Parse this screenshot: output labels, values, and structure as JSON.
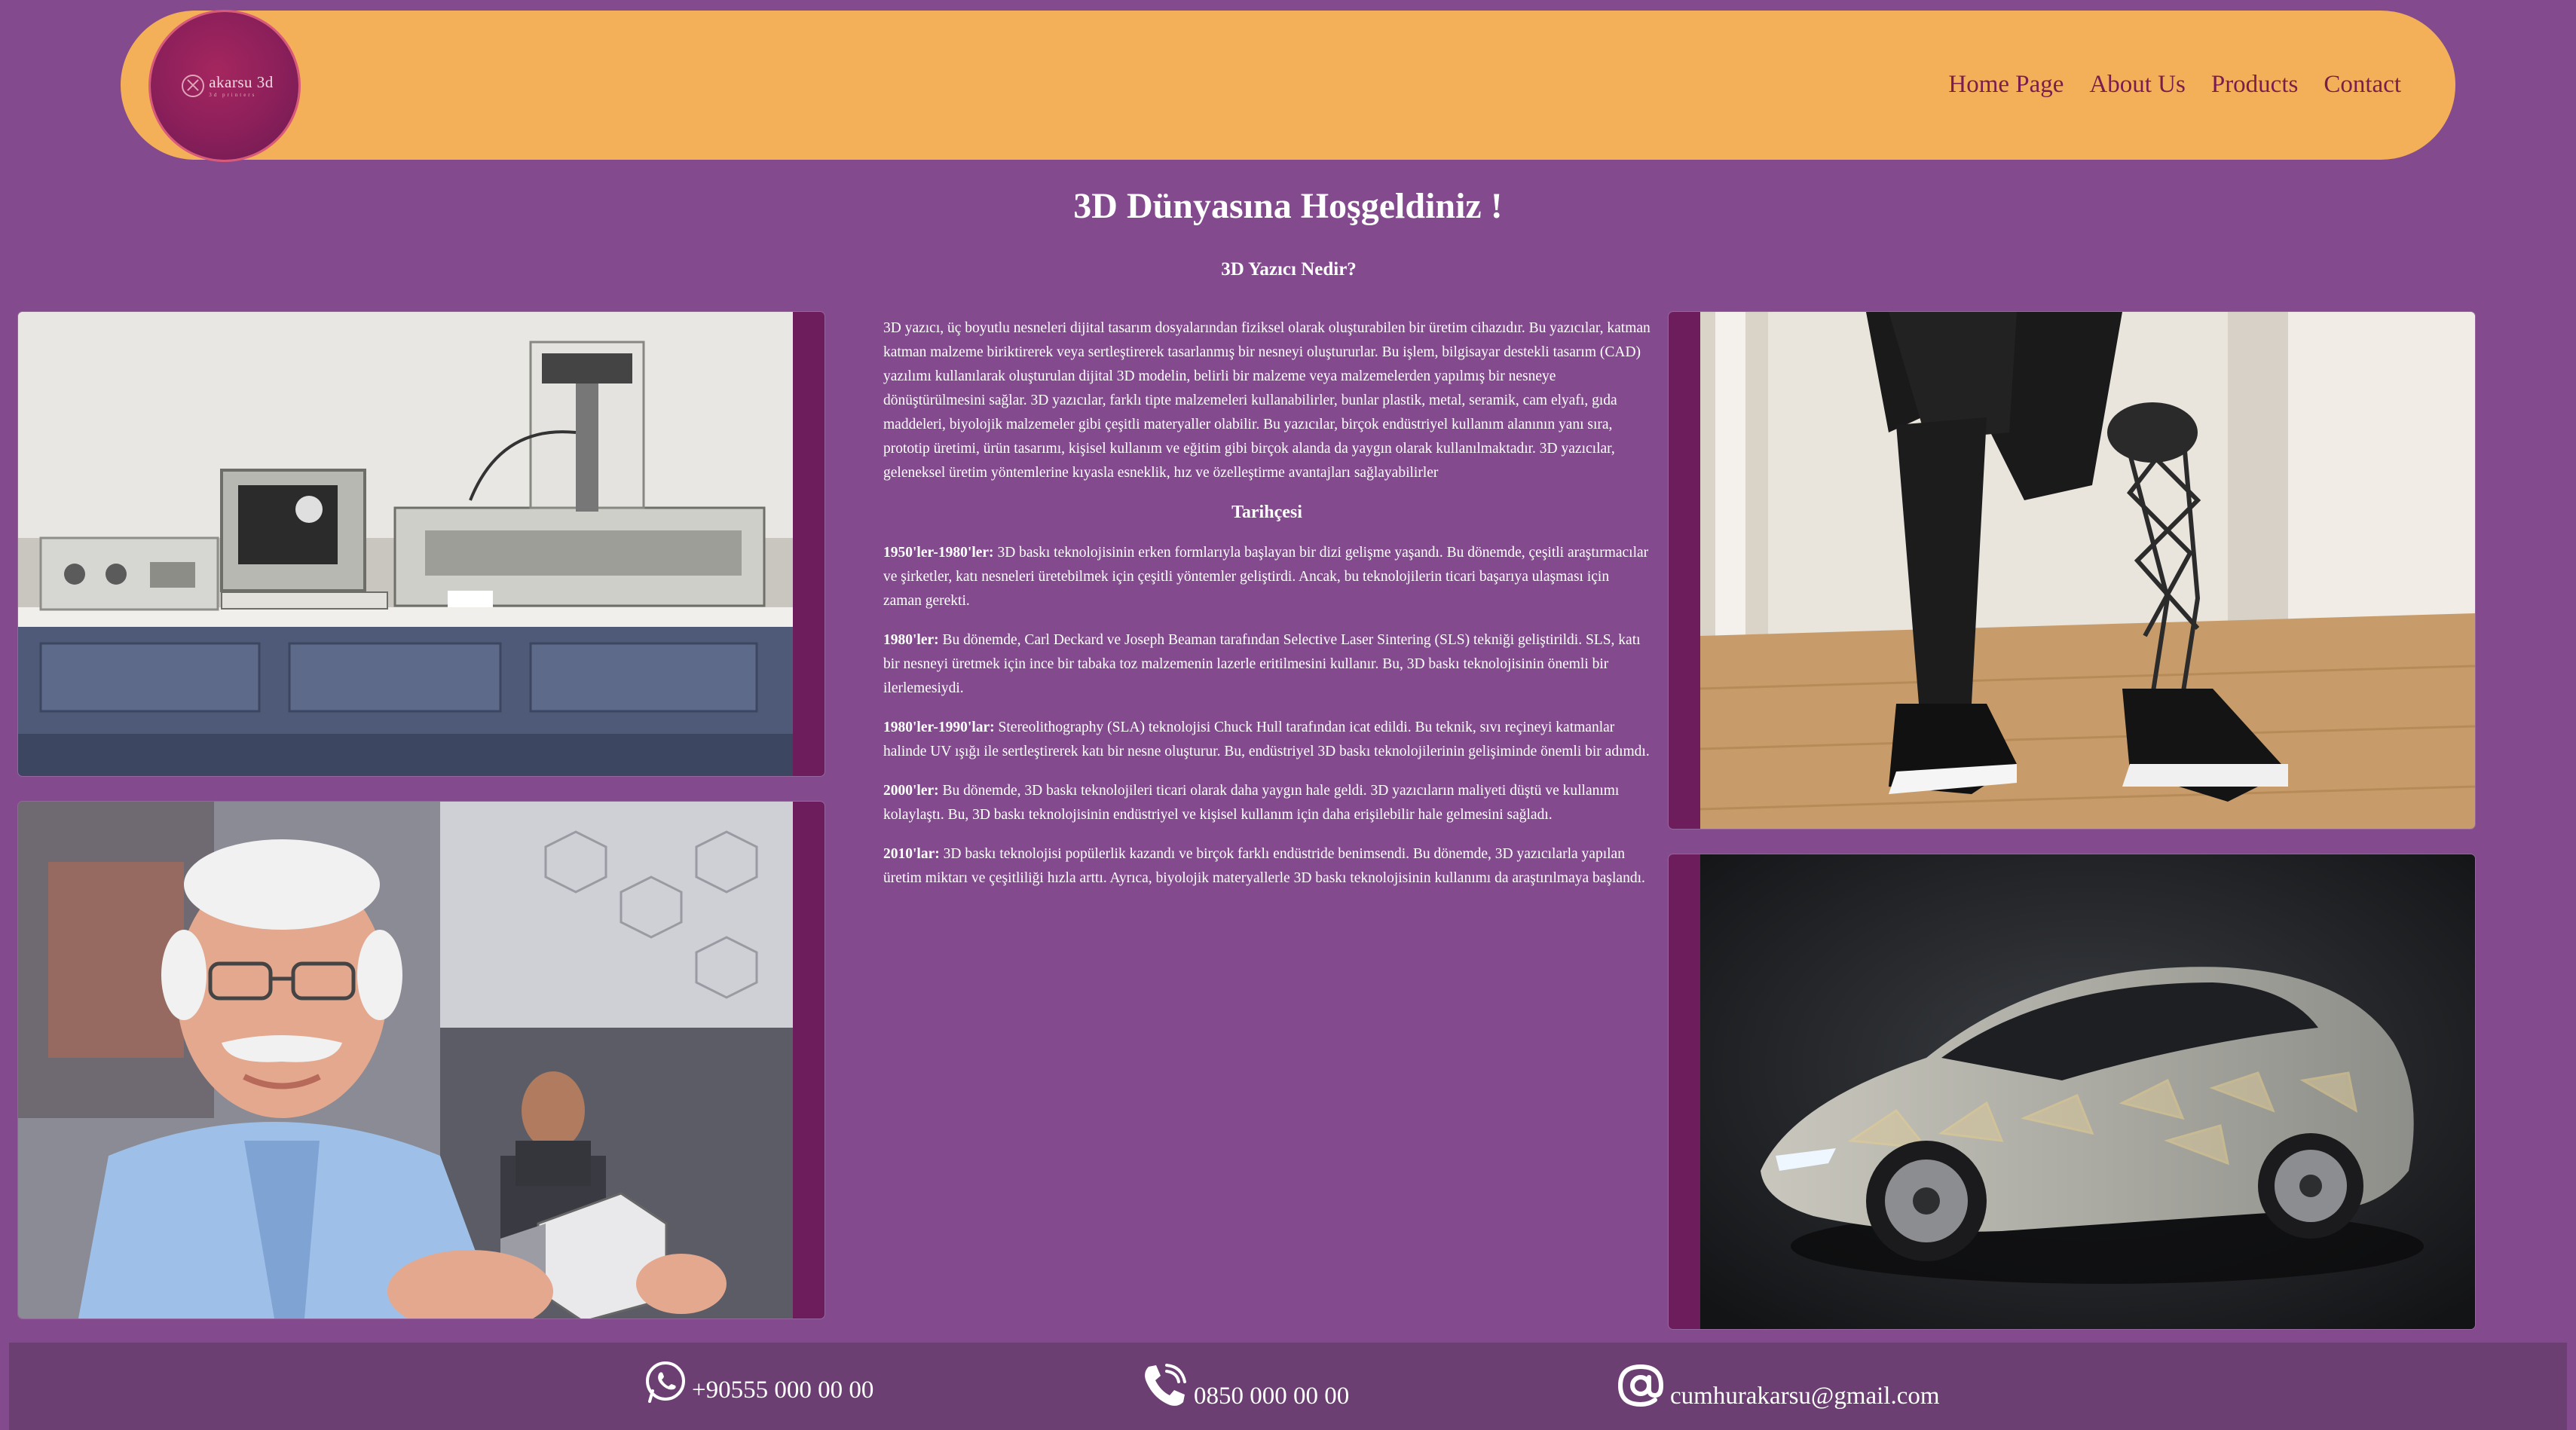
{
  "header": {
    "logo": {
      "name": "akarsu 3d",
      "tagline": "3d printers"
    },
    "nav": [
      "Home Page",
      "About Us",
      "Products",
      "Contact"
    ]
  },
  "main": {
    "title": "3D Dünyasına Hoşgeldiniz !",
    "subtitle": "3D Yazıcı Nedir?",
    "intro": "3D yazıcı, üç boyutlu nesneleri dijital tasarım dosyalarından fiziksel olarak oluşturabilen bir üretim cihazıdır. Bu yazıcılar, katman katman malzeme biriktirerek veya sertleştirerek tasarlanmış bir nesneyi oluştururlar. Bu işlem, bilgisayar destekli tasarım (CAD) yazılımı kullanılarak oluşturulan dijital 3D modelin, belirli bir malzeme veya malzemelerden yapılmış bir nesneye dönüştürülmesini sağlar. 3D yazıcılar, farklı tipte malzemeleri kullanabilirler, bunlar plastik, metal, seramik, cam elyafı, gıda maddeleri, biyolojik malzemeler gibi çeşitli materyaller olabilir. Bu yazıcılar, birçok endüstriyel kullanım alanının yanı sıra, prototip üretimi, ürün tasarımı, kişisel kullanım ve eğitim gibi birçok alanda da yaygın olarak kullanılmaktadır. 3D yazıcılar, geleneksel üretim yöntemlerine kıyasla esneklik, hız ve özelleştirme avantajları sağlayabilirler",
    "history_title": "Tarihçesi",
    "history": [
      {
        "period": "1950'ler-1980'ler:",
        "text": " 3D baskı teknolojisinin erken formlarıyla başlayan bir dizi gelişme yaşandı. Bu dönemde, çeşitli araştırmacılar ve şirketler, katı nesneleri üretebilmek için çeşitli yöntemler geliştirdi. Ancak, bu teknolojilerin ticari başarıya ulaşması için zaman gerekti."
      },
      {
        "period": "1980'ler:",
        "text": " Bu dönemde, Carl Deckard ve Joseph Beaman tarafından Selective Laser Sintering (SLS) tekniği geliştirildi. SLS, katı bir nesneyi üretmek için ince bir tabaka toz malzemenin lazerle eritilmesini kullanır. Bu, 3D baskı teknolojisinin önemli bir ilerlemesiydi."
      },
      {
        "period": "1980'ler-1990'lar:",
        "text": " Stereolithography (SLA) teknolojisi Chuck Hull tarafından icat edildi. Bu teknik, sıvı reçineyi katmanlar halinde UV ışığı ile sertleştirerek katı bir nesne oluşturur. Bu, endüstriyel 3D baskı teknolojilerinin gelişiminde önemli bir adımdı."
      },
      {
        "period": "2000'ler:",
        "text": " Bu dönemde, 3D baskı teknolojileri ticari olarak daha yaygın hale geldi. 3D yazıcıların maliyeti düştü ve kullanımı kolaylaştı. Bu, 3D baskı teknolojisinin endüstriyel ve kişisel kullanım için daha erişilebilir hale gelmesini sağladı."
      },
      {
        "period": "2010'lar:",
        "text": " 3D baskı teknolojisi popülerlik kazandı ve birçok farklı endüstride benimsendi. Bu dönemde, 3D yazıcılarla yapılan üretim miktarı ve çeşitliliği hızla arttı. Ayrıca, biyolojik materyallerle 3D baskı teknolojisinin kullanımı da araştırılmaya başlandı."
      }
    ]
  },
  "footer": {
    "phone_whatsapp": "+90555 000 00 00",
    "phone": "0850 000 00 00",
    "email": "cumhurakarsu@gmail.com"
  },
  "icons": [
    "whatsapp-icon",
    "phone-icon",
    "at-sign-icon"
  ],
  "colors": {
    "background": "#834b8e",
    "header": "#f3b059",
    "nav_text": "#7a1d4e",
    "footer": "#6c3f72",
    "frame_accent": "#6d1d5c"
  }
}
